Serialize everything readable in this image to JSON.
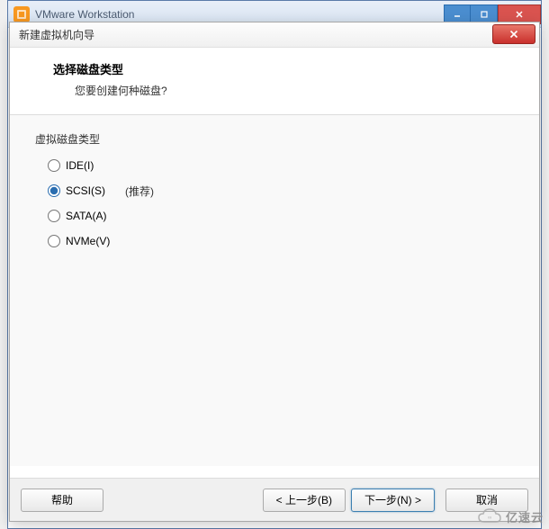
{
  "mainWindow": {
    "title": "VMware Workstation"
  },
  "wizard": {
    "title": "新建虚拟机向导",
    "header": {
      "heading": "选择磁盘类型",
      "subtext": "您要创建何种磁盘?"
    },
    "group": {
      "label": "虚拟磁盘类型",
      "options": {
        "ide": "IDE(I)",
        "scsi": "SCSI(S)",
        "scsi_rec": "(推荐)",
        "sata": "SATA(A)",
        "nvme": "NVMe(V)"
      }
    },
    "buttons": {
      "help": "帮助",
      "back": "< 上一步(B)",
      "next": "下一步(N) >",
      "cancel": "取消"
    }
  },
  "watermark": {
    "text": "亿速云"
  }
}
